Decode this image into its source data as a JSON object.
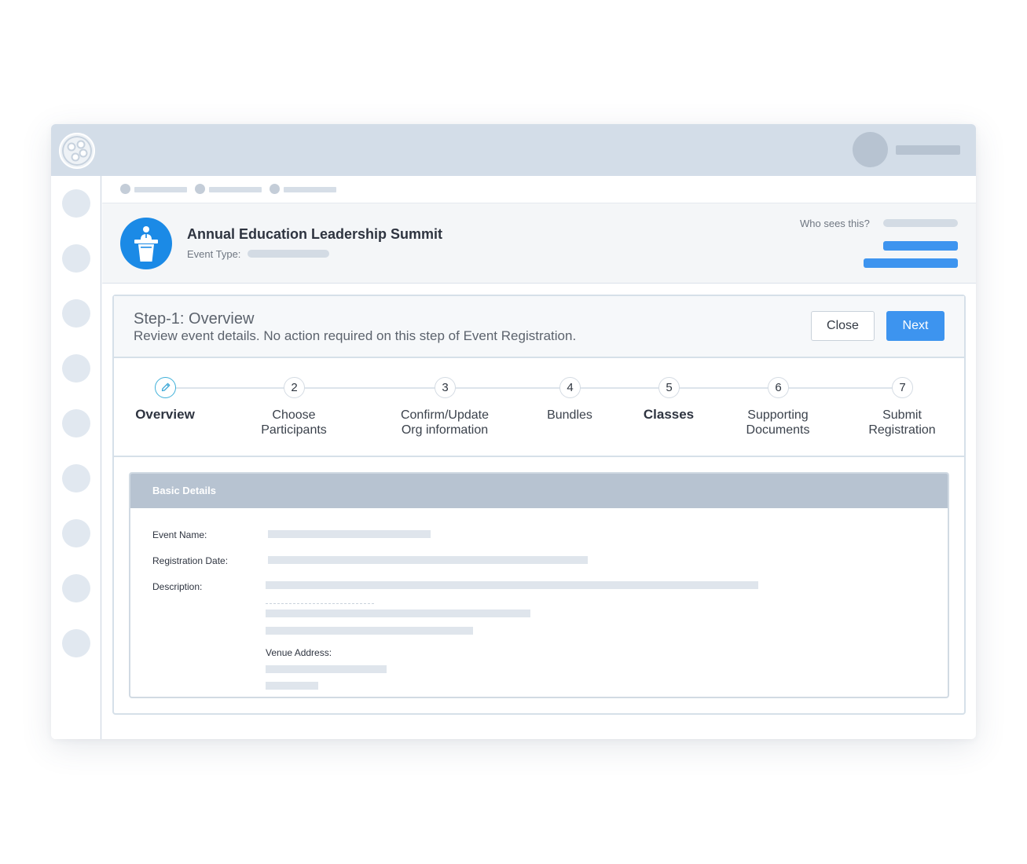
{
  "colors": {
    "topbar": "#d3dde8",
    "accent_blue": "#3d94ef",
    "event_icon_blue": "#1b8ae6",
    "active_step": "#3fb0d9",
    "details_header": "#b7c3d1"
  },
  "app": {
    "logo_icon": "film-reel-logo-icon"
  },
  "event": {
    "title": "Annual Education Leadership Summit",
    "type_label": "Event Type:",
    "icon": "podium-speaker-icon",
    "visibility_label": "Who sees this?"
  },
  "step": {
    "title": "Step-1: Overview",
    "subtitle": "Review event details. No action required on this step of Event Registration.",
    "close_label": "Close",
    "next_label": "Next"
  },
  "stepper": {
    "steps": [
      {
        "number": "",
        "label": "Overview",
        "icon": "pencil-icon",
        "active": true
      },
      {
        "number": "2",
        "label": "Choose\nParticipants"
      },
      {
        "number": "3",
        "label": "Confirm/Update\nOrg information"
      },
      {
        "number": "4",
        "label": "Bundles"
      },
      {
        "number": "5",
        "label": "Classes"
      },
      {
        "number": "6",
        "label": "Supporting\nDocuments"
      },
      {
        "number": "7",
        "label": "Submit\nRegistration"
      }
    ]
  },
  "details": {
    "title": "Basic Details",
    "event_name_label": "Event Name:",
    "registration_date_label": "Registration Date:",
    "description_label": "Description:",
    "venue_address_label": "Venue Address:"
  }
}
